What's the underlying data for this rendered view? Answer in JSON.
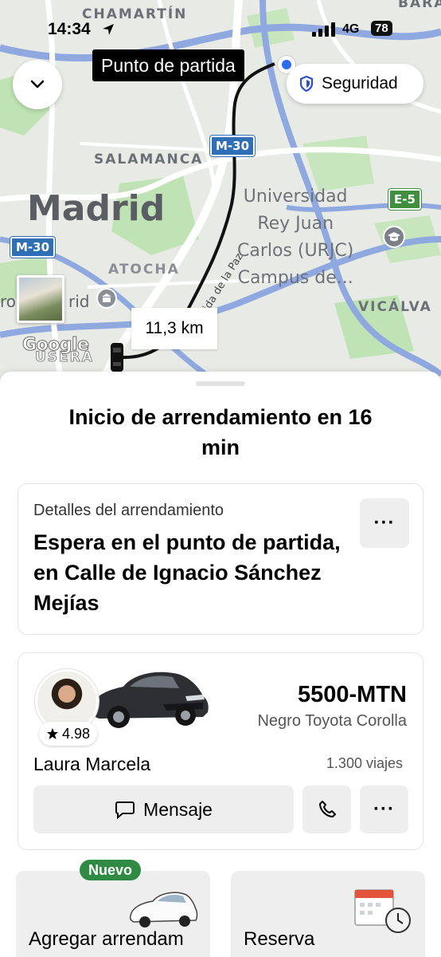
{
  "status_bar": {
    "time": "14:34",
    "network": "4G",
    "battery": "78"
  },
  "map": {
    "labels": {
      "chamartin": "CHAMARTÍN",
      "barajas": "BARA",
      "salamanca": "SALAMANCA",
      "madrid": "Madrid",
      "atocha": "ATOCHA",
      "usera": "USERA",
      "vicalvaro": "VICÁLVA",
      "street": "Avenida de la Paz",
      "university": [
        "Universidad",
        "Rey Juan",
        "Carlos (URJC)",
        "Campus de..."
      ],
      "left_cut": "ro",
      "left_cut2": "rid"
    },
    "road_shields": [
      "M-30",
      "M-30",
      "E-5"
    ],
    "pickup_label": "Punto de partida",
    "safety_label": "Seguridad",
    "distance": "11,3 km",
    "attribution": "Google"
  },
  "sheet": {
    "title": "Inicio de arrendamiento en 16 min",
    "details": {
      "label": "Detalles del arrendamiento",
      "text": "Espera en el punto de partida, en Calle de Ignacio Sánchez Mejías",
      "more": "···"
    },
    "driver": {
      "rating": "4.98",
      "plate": "5500-MTN",
      "car": "Negro Toyota Corolla",
      "name": "Laura Marcela",
      "trips": "1.300 viajes",
      "message_label": "Mensaje",
      "more": "···"
    },
    "tiles": {
      "badge": "Nuevo",
      "add": "Agregar arrendam",
      "reserve": "Reserva"
    }
  },
  "colors": {
    "accent_blue": "#2b6df0",
    "badge_green": "#2f8a43",
    "route": "#111111"
  },
  "icons": [
    "location-arrow-icon",
    "signal-icon",
    "chevron-down-icon",
    "shield-icon",
    "star-icon",
    "chat-icon",
    "phone-icon"
  ]
}
